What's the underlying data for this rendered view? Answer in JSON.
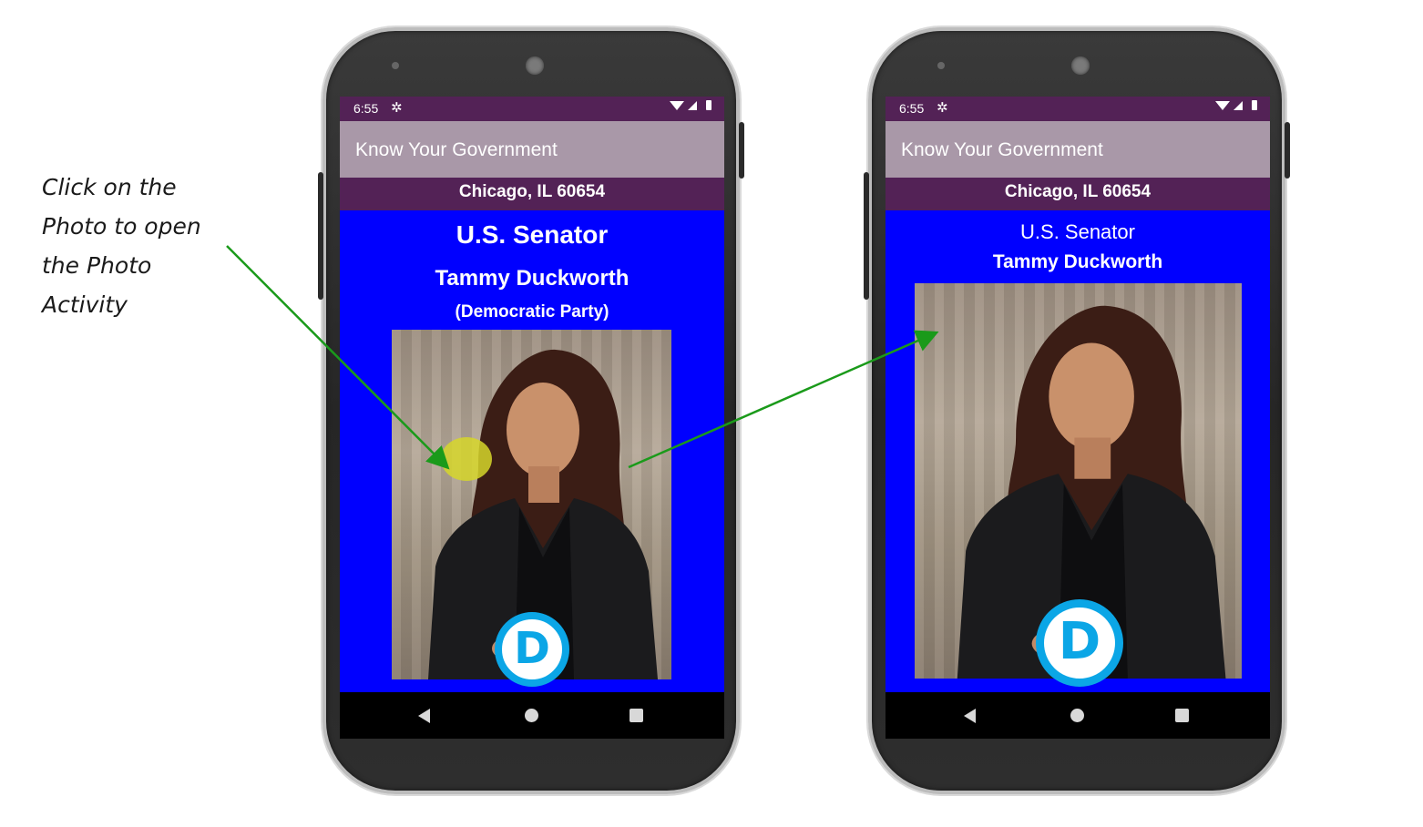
{
  "annotation": {
    "lines": [
      "Click on the",
      "Photo to open",
      "the Photo",
      "Activity"
    ]
  },
  "left_screen": {
    "status": {
      "time": "6:55",
      "settings_icon": "gear-icon"
    },
    "app_title": "Know Your Government",
    "location": "Chicago, IL 60654",
    "official": {
      "office": "U.S. Senator",
      "name": "Tammy Duckworth",
      "party": "(Democratic Party)"
    },
    "party_logo_letter": "D"
  },
  "right_screen": {
    "status": {
      "time": "6:55",
      "settings_icon": "gear-icon"
    },
    "app_title": "Know Your Government",
    "location": "Chicago, IL 60654",
    "official": {
      "office": "U.S. Senator",
      "name": "Tammy Duckworth"
    },
    "party_logo_letter": "D"
  },
  "colors": {
    "status_bar": "#532256",
    "toolbar": "#a998a8",
    "party_background": "#0000ff",
    "democratic_logo": "#0ba6e6",
    "arrow": "#1a9a1a",
    "tap_highlight": "#d6d62a"
  }
}
